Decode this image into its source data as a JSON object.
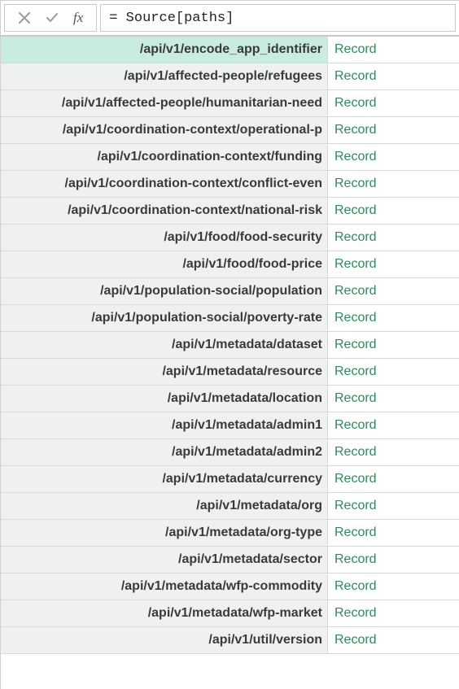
{
  "formulaBar": {
    "fxLabel": "fx",
    "formula": "= Source[paths]"
  },
  "valueLabel": "Record",
  "selectedIndex": 0,
  "rows": [
    {
      "path": "/api/v1/encode_app_identifier"
    },
    {
      "path": "/api/v1/affected-people/refugees"
    },
    {
      "path": "/api/v1/affected-people/humanitarian-need"
    },
    {
      "path": "/api/v1/coordination-context/operational-p"
    },
    {
      "path": "/api/v1/coordination-context/funding"
    },
    {
      "path": "/api/v1/coordination-context/conflict-even"
    },
    {
      "path": "/api/v1/coordination-context/national-risk"
    },
    {
      "path": "/api/v1/food/food-security"
    },
    {
      "path": "/api/v1/food/food-price"
    },
    {
      "path": "/api/v1/population-social/population"
    },
    {
      "path": "/api/v1/population-social/poverty-rate"
    },
    {
      "path": "/api/v1/metadata/dataset"
    },
    {
      "path": "/api/v1/metadata/resource"
    },
    {
      "path": "/api/v1/metadata/location"
    },
    {
      "path": "/api/v1/metadata/admin1"
    },
    {
      "path": "/api/v1/metadata/admin2"
    },
    {
      "path": "/api/v1/metadata/currency"
    },
    {
      "path": "/api/v1/metadata/org"
    },
    {
      "path": "/api/v1/metadata/org-type"
    },
    {
      "path": "/api/v1/metadata/sector"
    },
    {
      "path": "/api/v1/metadata/wfp-commodity"
    },
    {
      "path": "/api/v1/metadata/wfp-market"
    },
    {
      "path": "/api/v1/util/version"
    }
  ]
}
